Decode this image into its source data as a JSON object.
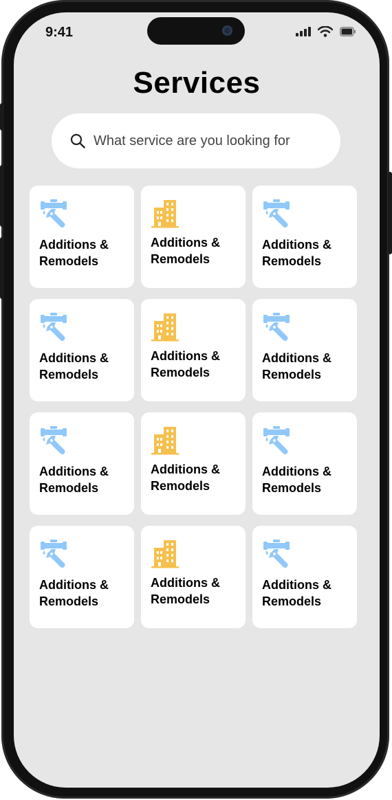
{
  "status_bar": {
    "time": "9:41"
  },
  "header": {
    "title": "Services"
  },
  "search": {
    "placeholder": "What service are you looking for"
  },
  "colors": {
    "plumbing_icon": "#90C8FA",
    "building_icon": "#F6C04E",
    "screen_bg": "#E6E6E6",
    "card_bg": "#FFFFFF"
  },
  "services": [
    {
      "icon": "plumbing-icon",
      "line1": "Additions &",
      "line2": "Remodels"
    },
    {
      "icon": "building-icon",
      "line1": "Additions &",
      "line2": "Remodels"
    },
    {
      "icon": "plumbing-icon",
      "line1": "Additions &",
      "line2": "Remodels"
    },
    {
      "icon": "plumbing-icon",
      "line1": "Additions &",
      "line2": "Remodels"
    },
    {
      "icon": "building-icon",
      "line1": "Additions &",
      "line2": "Remodels"
    },
    {
      "icon": "plumbing-icon",
      "line1": "Additions &",
      "line2": "Remodels"
    },
    {
      "icon": "plumbing-icon",
      "line1": "Additions &",
      "line2": "Remodels"
    },
    {
      "icon": "building-icon",
      "line1": "Additions &",
      "line2": "Remodels"
    },
    {
      "icon": "plumbing-icon",
      "line1": "Additions &",
      "line2": "Remodels"
    },
    {
      "icon": "plumbing-icon",
      "line1": "Additions &",
      "line2": "Remodels"
    },
    {
      "icon": "building-icon",
      "line1": "Additions &",
      "line2": "Remodels"
    },
    {
      "icon": "plumbing-icon",
      "line1": "Additions &",
      "line2": "Remodels"
    }
  ]
}
